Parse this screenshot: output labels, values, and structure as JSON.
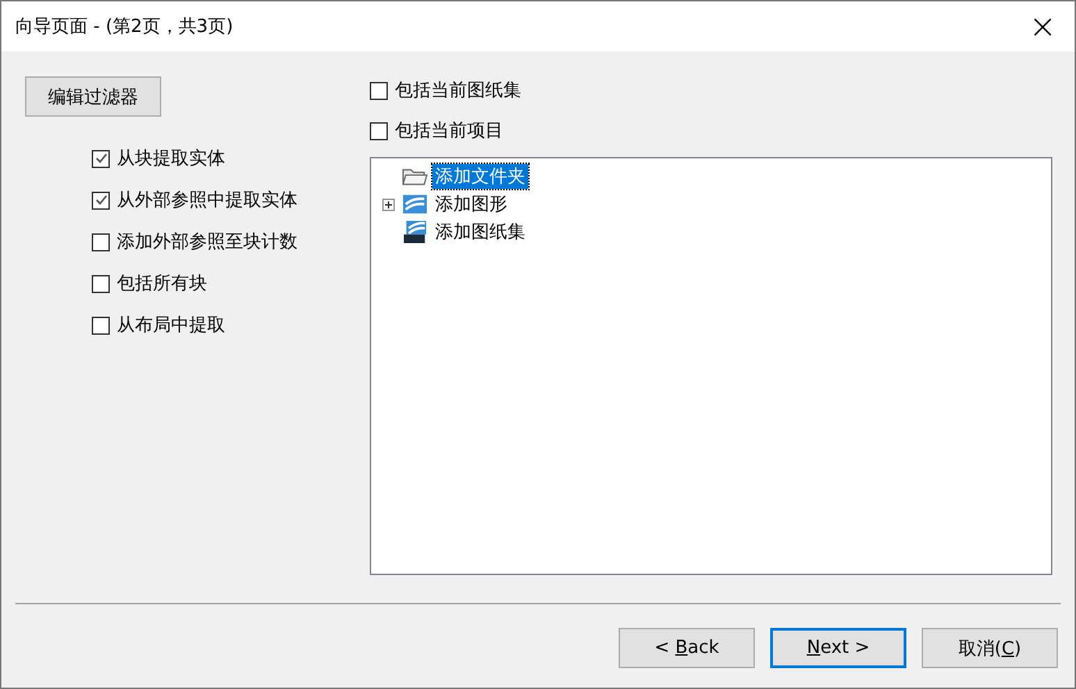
{
  "window": {
    "title": "向导页面 - (第2页，共3页)",
    "close": "×"
  },
  "edit_filter_button": "编辑过滤器",
  "options": [
    {
      "label": "从块提取实体",
      "checked": true
    },
    {
      "label": "从外部参照中提取实体",
      "checked": true
    },
    {
      "label": "添加外部参照至块计数",
      "checked": false
    },
    {
      "label": "包括所有块",
      "checked": false
    },
    {
      "label": "从布局中提取",
      "checked": false
    }
  ],
  "include_options": [
    {
      "label": "包括当前图纸集",
      "checked": false
    },
    {
      "label": "包括当前项目",
      "checked": false
    }
  ],
  "tree": [
    {
      "label": "添加文件夹",
      "kind": "folder",
      "selected": true
    },
    {
      "label": "添加图形",
      "kind": "drawing",
      "selected": false,
      "expanded": false
    },
    {
      "label": "添加图纸集",
      "kind": "sheetset",
      "selected": false
    }
  ],
  "buttons": [
    {
      "before": "< ",
      "key": "B",
      "after": "ack",
      "default": false
    },
    {
      "key": "N",
      "after": "ext >",
      "default": true
    },
    {
      "before": "取消(",
      "key": "C",
      "after": ")",
      "default": false
    }
  ]
}
